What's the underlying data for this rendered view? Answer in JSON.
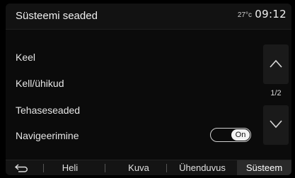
{
  "header": {
    "title": "Süsteemi seaded",
    "temperature": "27°c",
    "time": "09:12"
  },
  "menu": {
    "items": [
      {
        "label": "Keel"
      },
      {
        "label": "Kell/ühikud"
      },
      {
        "label": "Tehaseseaded"
      },
      {
        "label": "Navigeerimine",
        "toggle": "On"
      }
    ]
  },
  "scroll": {
    "page": "1/2",
    "up_icon": "chevron-up-icon",
    "down_icon": "chevron-down-icon"
  },
  "bottom_bar": {
    "back_icon": "back-arrow-icon",
    "tabs": [
      {
        "label": "Heli"
      },
      {
        "label": "Kuva"
      },
      {
        "label": "Ühenduvus"
      },
      {
        "label": "Süsteem",
        "active": true
      }
    ]
  },
  "colors": {
    "background": "#0b0b0b",
    "active_tab": "#2a2a2a",
    "text": "#e6e6e6"
  }
}
